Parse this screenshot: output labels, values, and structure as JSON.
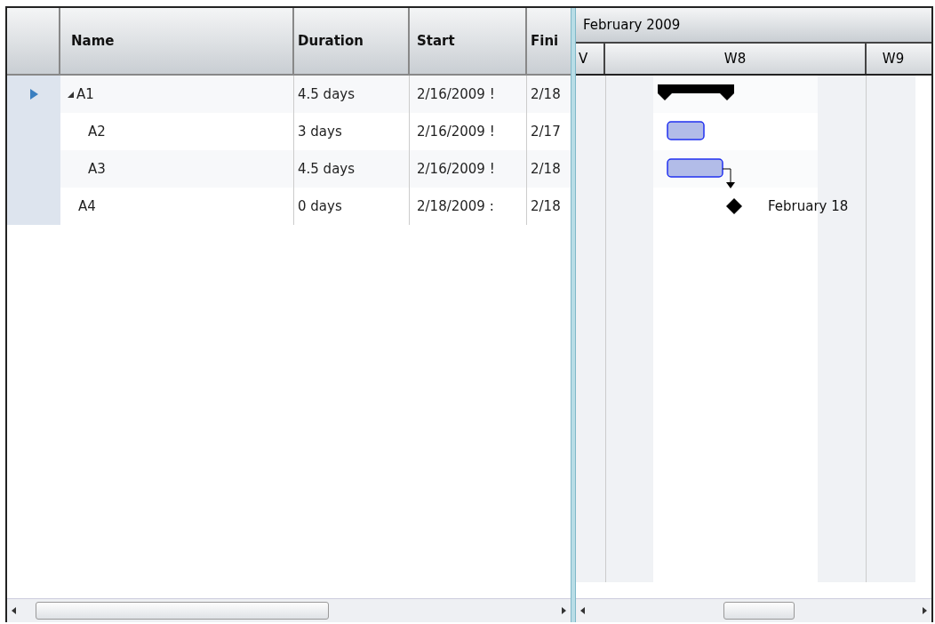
{
  "grid": {
    "columns": [
      {
        "label": "Name"
      },
      {
        "label": "Duration"
      },
      {
        "label": "Start"
      },
      {
        "label": "Fini"
      }
    ],
    "rows": [
      {
        "name": "A1",
        "duration": "4.5 days",
        "start": "2/16/2009 !",
        "finish": "2/18",
        "selected": true,
        "expanded": true,
        "children": [
          {
            "name": "A2",
            "duration": "3 days",
            "start": "2/16/2009 !",
            "finish": "2/17",
            "selected": false
          },
          {
            "name": "A3",
            "duration": "4.5 days",
            "start": "2/16/2009 !",
            "finish": "2/18",
            "selected": false
          }
        ]
      },
      {
        "name": "A4",
        "duration": "0 days",
        "start": "2/18/2009 :",
        "finish": "2/18",
        "selected": false
      }
    ]
  },
  "timeline": {
    "month": "February 2009",
    "weeks": [
      "V",
      "W8",
      "W9"
    ]
  },
  "gantt": {
    "items": [
      {
        "kind": "summary"
      },
      {
        "kind": "task"
      },
      {
        "kind": "task"
      },
      {
        "kind": "milestone",
        "label": "February 18"
      }
    ]
  }
}
